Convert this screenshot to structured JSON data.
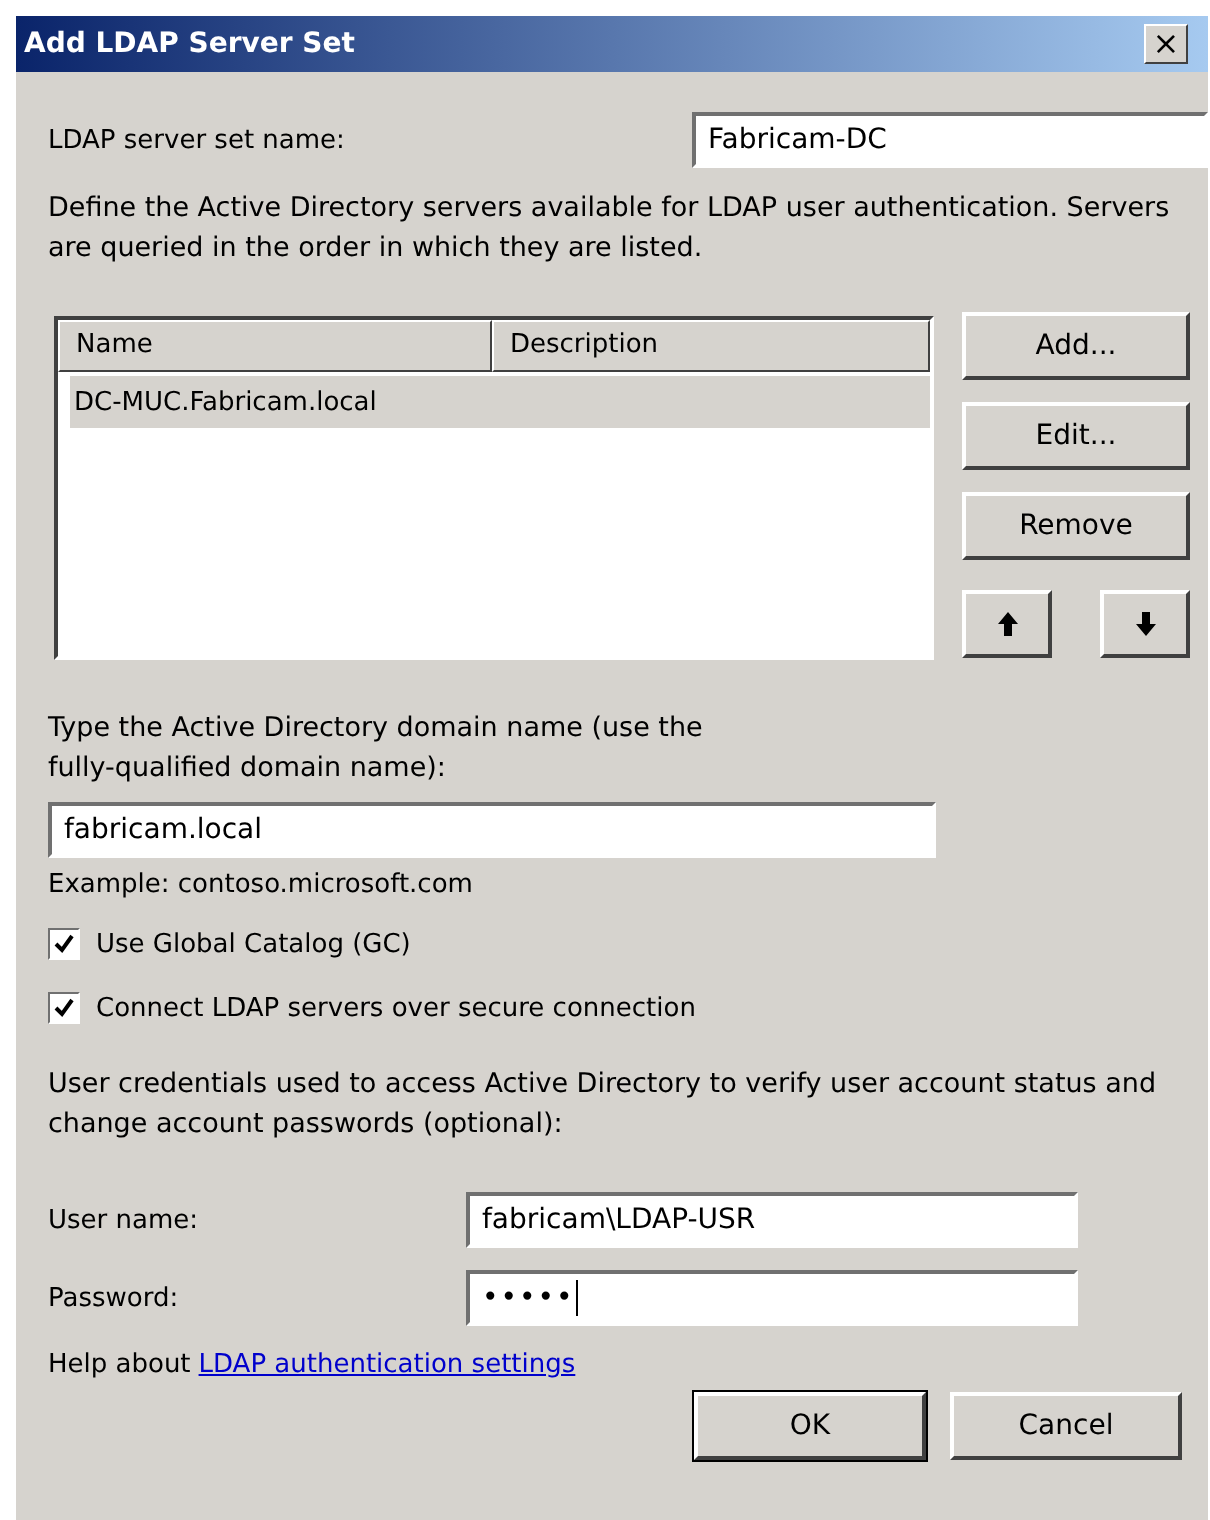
{
  "window": {
    "title": "Add LDAP Server Set",
    "close": "×"
  },
  "set_name": {
    "label": "LDAP server set name:",
    "value": "Fabricam-DC"
  },
  "intro": "Define the Active Directory servers available for LDAP user authentication. Servers are queried in the order in which they are listed.",
  "servers": {
    "columns": [
      "Name",
      "Description"
    ],
    "rows": [
      {
        "name": "DC-MUC.Fabricam.local",
        "description": "",
        "selected": true
      }
    ]
  },
  "server_buttons": [
    "Add...",
    "Edit...",
    "Remove"
  ],
  "domain": {
    "label": "Type the Active Directory domain name (use the fully-qualified domain name):",
    "value": "fabricam.local",
    "example": "Example: contoso.microsoft.com"
  },
  "options": [
    {
      "label": "Use Global Catalog (GC)",
      "checked": true
    },
    {
      "label": "Connect LDAP servers over secure connection",
      "checked": true
    }
  ],
  "credentials": {
    "intro": "User credentials used to access Active Directory to verify user account status and change account passwords (optional):",
    "fields": [
      {
        "label": "User name:",
        "value": "fabricam\\LDAP-USR",
        "kind": "text"
      },
      {
        "label": "Password:",
        "value": "•••••",
        "kind": "password"
      }
    ]
  },
  "help": {
    "prefix": "Help about",
    "link": "LDAP authentication settings"
  },
  "buttons": [
    "OK",
    "Cancel"
  ]
}
